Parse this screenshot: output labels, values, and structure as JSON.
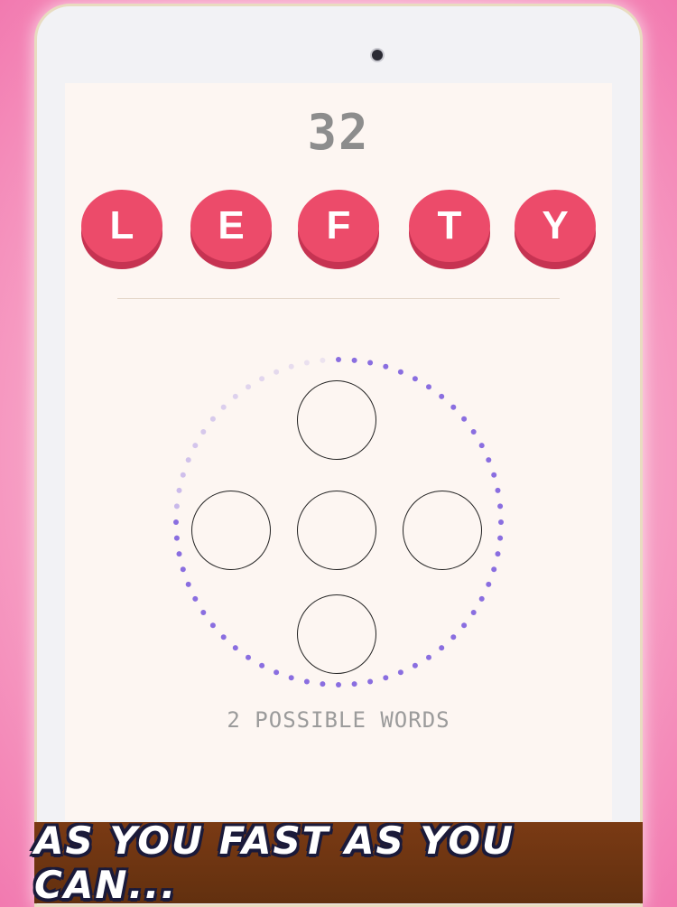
{
  "game": {
    "timer": "32",
    "letters": [
      "L",
      "E",
      "F",
      "T",
      "Y"
    ],
    "possible_words": "2 POSSIBLE WORDS",
    "countdown_progress": 0.75
  },
  "banner": {
    "text": "AS YOU FAST AS YOU CAN..."
  },
  "colors": {
    "tile": "#ec4b6a",
    "tile_shadow": "#c63352",
    "ring_dots": "#8a6ee0",
    "banner_bg": "#6e3512"
  }
}
